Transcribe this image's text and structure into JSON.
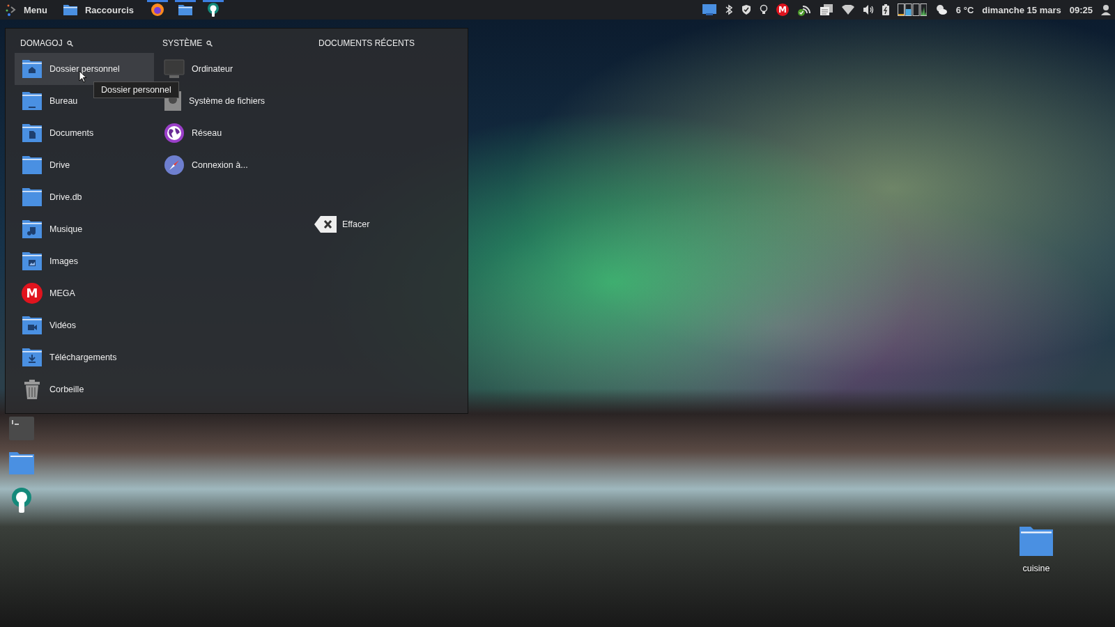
{
  "top_bar": {
    "menu_label": "Menu",
    "shortcuts_label": "Raccourcis",
    "mega_letter": "M",
    "weather": "6 °C",
    "date": "dimanche 15 mars",
    "time": "09:25"
  },
  "menu": {
    "columns": [
      {
        "heading": "DOMAGOJ",
        "items": [
          {
            "label": "Dossier personnel",
            "kind": "home",
            "selected": true
          },
          {
            "label": "Bureau",
            "kind": "desktop",
            "selected": false
          },
          {
            "label": "Documents",
            "kind": "document",
            "selected": false
          },
          {
            "label": "Drive",
            "kind": "folder",
            "selected": false
          },
          {
            "label": "Drive.db",
            "kind": "folder",
            "selected": false
          },
          {
            "label": "Musique",
            "kind": "music",
            "selected": false
          },
          {
            "label": "Images",
            "kind": "image",
            "selected": false
          },
          {
            "label": "MEGA",
            "kind": "mega",
            "logo_letter": "M",
            "selected": false
          },
          {
            "label": "Vidéos",
            "kind": "video",
            "selected": false
          },
          {
            "label": "Téléchargements",
            "kind": "download",
            "selected": false
          },
          {
            "label": "Corbeille",
            "kind": "trash",
            "selected": false
          }
        ]
      },
      {
        "heading": "SYSTÈME",
        "items": [
          {
            "label": "Ordinateur",
            "kind": "computer",
            "selected": false
          },
          {
            "label": "Système de fichiers",
            "kind": "disk",
            "selected": false
          },
          {
            "label": "Réseau",
            "kind": "globe",
            "selected": false
          },
          {
            "label": "Connexion à...",
            "kind": "compass",
            "selected": false
          }
        ]
      }
    ],
    "recent": {
      "heading": "DOCUMENTS RÉCENTS",
      "clear_label": "Effacer"
    },
    "tooltip": "Dossier personnel"
  },
  "desktop_icons": [
    {
      "label": "cuisine"
    }
  ]
}
